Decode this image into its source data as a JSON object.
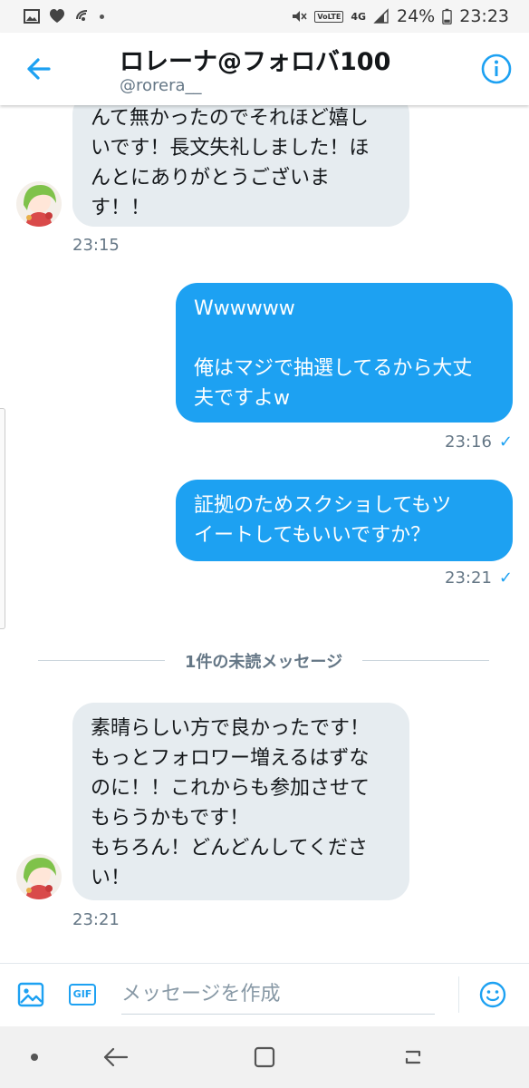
{
  "status_bar": {
    "battery": "24%",
    "time": "23:23",
    "network": "4G"
  },
  "header": {
    "title": "ロレーナ@フォロバ100",
    "handle": "@rorera__"
  },
  "messages": {
    "m1": {
      "lines": [
        "んて無かったのでそれほど嬉し",
        "いです！長文失礼しました！ほ",
        "んとにありがとうございま",
        "す！！"
      ],
      "time": "23:15"
    },
    "m2": {
      "lines": [
        "Wwwwww",
        "",
        "俺はマジで抽選してるから大丈",
        "夫ですよw"
      ],
      "time": "23:16",
      "read_mark": "✓"
    },
    "m3": {
      "lines": [
        "証拠のためスクショしてもツ",
        "イートしてもいいですか？"
      ],
      "time": "23:21",
      "read_mark": "✓"
    },
    "m4": {
      "lines": [
        "素晴らしい方で良かったです！",
        "もっとフォロワー増えるはずな",
        "のに！！これからも参加させて",
        "もらうかもです！",
        "もちろん！どんどんしてくださ",
        "い！"
      ],
      "time": "23:21"
    }
  },
  "divider": {
    "label": "1件の未読メッセージ"
  },
  "composer": {
    "placeholder": "メッセージを作成",
    "gif_label": "GIF"
  },
  "colors": {
    "accent": "#1da1f2",
    "received_bubble": "#e6ecf0",
    "secondary_text": "#657786"
  }
}
